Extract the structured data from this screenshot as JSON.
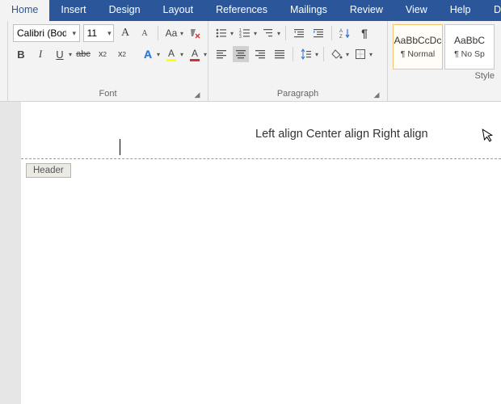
{
  "tabs": {
    "home": "Home",
    "insert": "Insert",
    "design": "Design",
    "layout": "Layout",
    "references": "References",
    "mailings": "Mailings",
    "review": "Review",
    "view": "View",
    "help": "Help",
    "trunc": "D"
  },
  "font": {
    "family": "Calibri (Body)",
    "size": "11",
    "grow": "A",
    "shrink": "A",
    "case": "Aa",
    "bold": "B",
    "italic": "I",
    "underline": "U",
    "strike": "abc",
    "sub": "x",
    "sub2": "2",
    "sup": "x",
    "sup2": "2",
    "effects": "A",
    "highlight": "A",
    "color": "A",
    "group_label": "Font"
  },
  "para": {
    "group_label": "Paragraph"
  },
  "styles": {
    "sample": "AaBbCcDc",
    "sample2": "AaBbC",
    "normal": "¶ Normal",
    "nospace": "¶ No Sp",
    "group_label": "Style"
  },
  "doc": {
    "header_text": "Left align Center align Right align",
    "header_tag": "Header"
  }
}
